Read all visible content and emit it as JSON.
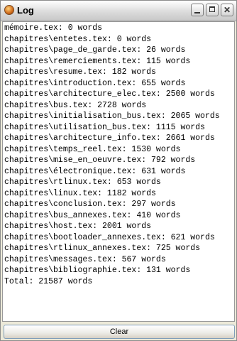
{
  "window": {
    "title": "Log",
    "app_icon": "java-cup-icon",
    "buttons": {
      "minimize_icon": "minimize-icon",
      "maximize_icon": "maximize-icon",
      "close_icon": "close-icon",
      "close_glyph": "✕"
    }
  },
  "log": {
    "lines": [
      "mémoire.tex: 0 words",
      "chapitres\\entetes.tex: 0 words",
      "chapitres\\page_de_garde.tex: 26 words",
      "chapitres\\remerciements.tex: 115 words",
      "chapitres\\resume.tex: 182 words",
      "chapitres\\introduction.tex: 655 words",
      "chapitres\\architecture_elec.tex: 2500 words",
      "chapitres\\bus.tex: 2728 words",
      "chapitres\\initialisation_bus.tex: 2065 words",
      "chapitres\\utilisation_bus.tex: 1115 words",
      "chapitres\\architecture_info.tex: 2661 words",
      "chapitres\\temps_reel.tex: 1530 words",
      "chapitres\\mise_en_oeuvre.tex: 792 words",
      "chapitres\\électronique.tex: 631 words",
      "chapitres\\rtlinux.tex: 653 words",
      "chapitres\\linux.tex: 1182 words",
      "chapitres\\conclusion.tex: 297 words",
      "chapitres\\bus_annexes.tex: 410 words",
      "chapitres\\host.tex: 2001 words",
      "chapitres\\bootloader_annexes.tex: 621 words",
      "chapitres\\rtlinux_annexes.tex: 725 words",
      "chapitres\\messages.tex: 567 words",
      "chapitres\\bibliographie.tex: 131 words",
      "Total: 21587 words"
    ]
  },
  "footer": {
    "clear_label": "Clear"
  }
}
